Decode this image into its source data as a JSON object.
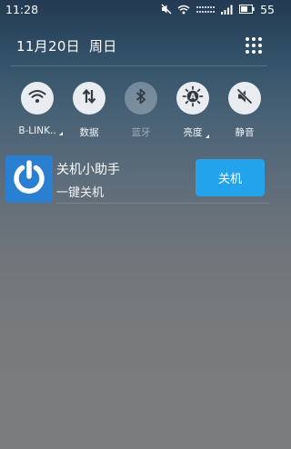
{
  "status_bar": {
    "time": "11:28",
    "battery": "55",
    "icons": [
      "mute-icon",
      "wifi-icon",
      "signal-icon",
      "signal-bars-icon",
      "battery-icon"
    ]
  },
  "header": {
    "date": "11月20日",
    "weekday": "周日",
    "settings_icon": "grid-icon"
  },
  "quick_toggles": [
    {
      "label": "B-LINK..",
      "icon": "wifi-icon",
      "active": true
    },
    {
      "label": "数据",
      "icon": "data-transfer-icon",
      "active": true
    },
    {
      "label": "蓝牙",
      "icon": "bluetooth-icon",
      "active": false
    },
    {
      "label": "亮度",
      "icon": "brightness-auto-icon",
      "active": true
    },
    {
      "label": "静音",
      "icon": "mute-icon",
      "active": true
    }
  ],
  "notification": {
    "app_icon": "power-icon",
    "title": "关机小助手",
    "subtitle": "一键关机",
    "button_label": "关机",
    "button_color": "#22a3ec",
    "icon_color": "#2a7fd1"
  }
}
